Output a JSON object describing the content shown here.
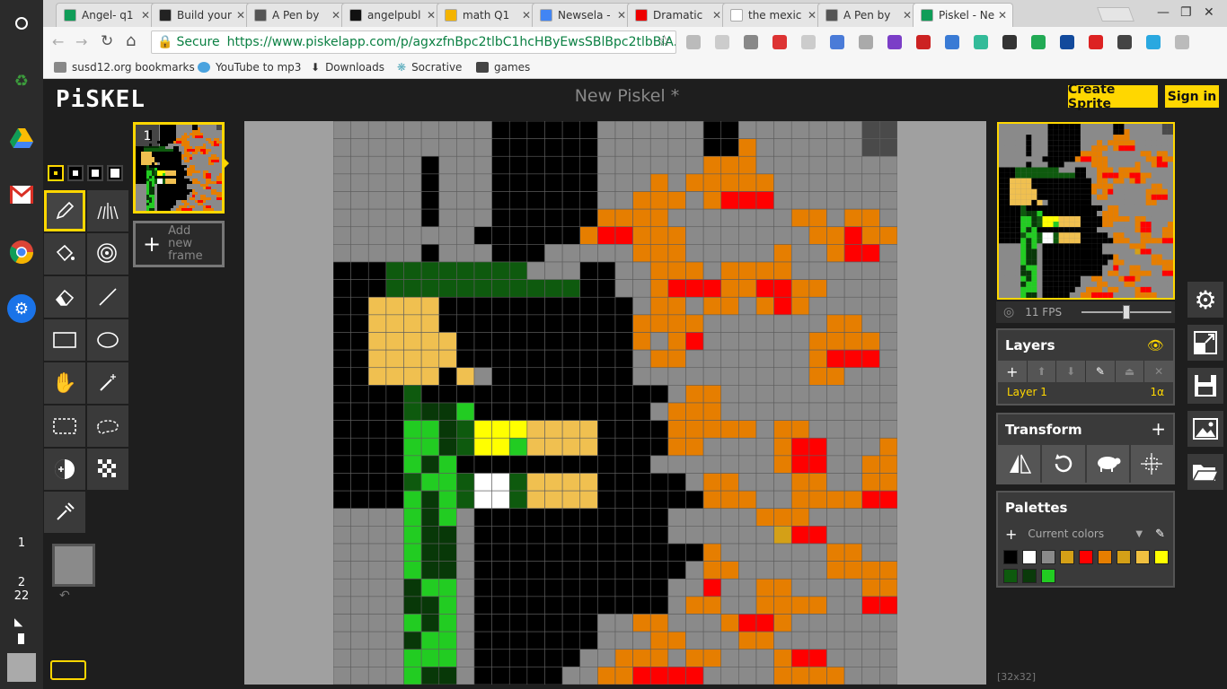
{
  "browser": {
    "tabs": [
      {
        "title": "Angel- q1",
        "color": "#0f9d58",
        "icon": "sheets-icon"
      },
      {
        "title": "Build your",
        "color": "#222",
        "icon": "bolt-icon"
      },
      {
        "title": "A Pen by",
        "color": "#555",
        "icon": "codepen-icon"
      },
      {
        "title": "angelpubl",
        "color": "#111",
        "icon": "github-icon"
      },
      {
        "title": "math Q1",
        "color": "#f4b400",
        "icon": "slides-icon"
      },
      {
        "title": "Newsela -",
        "color": "#4285f4",
        "icon": "docs-icon"
      },
      {
        "title": "Dramatic",
        "color": "#e00",
        "icon": "youtube-icon"
      },
      {
        "title": "the mexic",
        "color": "#fff",
        "icon": "google-icon"
      },
      {
        "title": "A Pen by",
        "color": "#555",
        "icon": "codepen-icon"
      },
      {
        "title": "Piskel - Ne",
        "color": "#0f9d58",
        "icon": "piskel-icon"
      }
    ],
    "secure_label": "Secure",
    "url": "https://www.piskelapp.com/p/agxzfnBpc2tlbC1hcHByEwsSBlBpc2tlbBiA...",
    "bookmarks": [
      "susd12.org bookmarks",
      "YouTube to mp3",
      "Downloads",
      "Socrative",
      "games"
    ]
  },
  "shelf": {
    "clock_hour": "2",
    "clock_min": "22",
    "notif": "1"
  },
  "piskel": {
    "logo": "PiSKEL",
    "title": "New Piskel *",
    "create_label": "Create Sprite",
    "signin_label": "Sign in",
    "frame_number": "1",
    "add_frame_label": "Add new frame",
    "fps": "11 FPS",
    "fps_fraction": 0.5,
    "size_label": "[32x32]",
    "layers_title": "Layers",
    "layer_name": "Layer 1",
    "layer_opacity": "1α",
    "transform_title": "Transform",
    "palettes_title": "Palettes",
    "palette_select": "Current colors",
    "palette_colors": [
      "#000000",
      "#ffffff",
      "#8a8a8a",
      "#d4a017",
      "#ff0000",
      "#e67e00",
      "#d4a017",
      "#f0c040",
      "#ffff00",
      "#0e5a0e",
      "#0a3a0a",
      "#22cc22"
    ]
  },
  "sprite": {
    "palette": {
      ".": "#8a8a8a",
      "k": "#000000",
      "o": "#e67e00",
      "r": "#ff0000",
      "g": "#0e5a0e",
      "d": "#083808",
      "l": "#22cc22",
      "s": "#f0c050",
      "y": "#ffff00",
      "w": "#ffffff",
      "t": "#4a4a4a",
      "c": "#d4a017"
    },
    "rows": [
      ".........kkkkkk......kk.......tt",
      ".........kkkkkk......kko......tt",
      ".....k...kkkkkk......ooo........",
      ".....k...kkkkkk...o.ooooo.......",
      ".....k...kkkkkk..ooo.orrr.......",
      ".....k...kkkkkkoooo.......oo.oo.",
      "........kkkkkkorrooo.......ooroo",
      ".....k...kkk.....ooo.....o..orr.",
      "kkkgggggggg...kk..ooo.oooo......",
      "kkkgggggggggggkk..orrroorroo....",
      "kksssskkkkkkkkkkk.oo.oo.oro.....",
      "kksssskkkkkkkkkkkoooo.......oo..",
      "kkssssskkkkkkkkkko.or......oooo.",
      "kkssssskkkkkkkkkk.oo.......orrr.",
      "kkssssks.kkkkkkkk..........oo...",
      "kkkkgkkkkkkkkkkkkkk.oo..........",
      "kkkkgddlkkkkkkkkkk.ooo..........",
      "kkkklldgyyysssskkkkooooo.oo.....",
      "kkkklldgyylsssskkkkoo....orr...o",
      "kkkkldlkkkkkkkkkkk.......orr..oo",
      "kkkkgllgwwgsssskkkkk.oo...oo..oo",
      "kkkkldlgwwgsssskkkkkkooo..oooorr",
      "....ldl.kkkkkkkkkkk.....ooo.....",
      "....ldd.kkkkkkkkkkk......crr....",
      "....ldd.kkkkkkkkkkkkko......oo..",
      "....ldd.kkkkkkkkkkkk.oo.....oooo",
      "....dll.kkkkkkkkkkk..r..oo....oo",
      "....ddl.kkkkkkkkkkk.oo..oooo..rr",
      "....ldl.kkkkkkk..oo...orro......",
      "....dll.kkkkkkk...oo...oo.......",
      "....lll.kkkkkk..ooo.oo...orr....",
      "....ldd.kkkkk..oorrrr....oooo...."
    ]
  }
}
